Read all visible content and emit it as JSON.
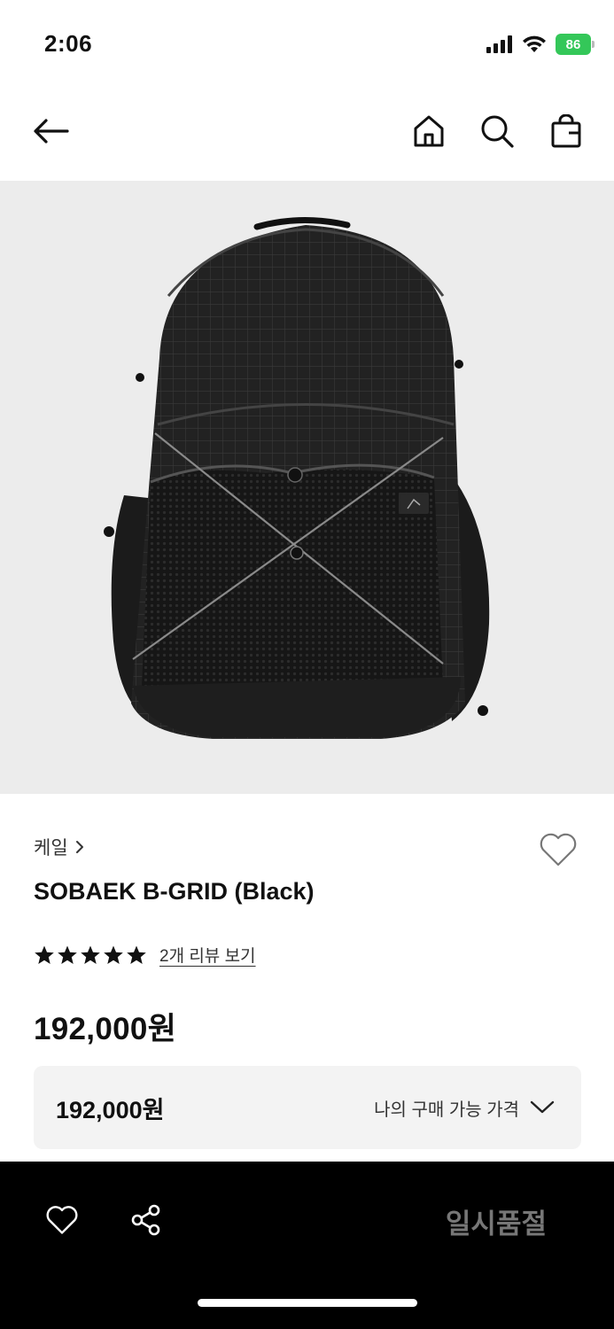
{
  "status": {
    "time": "2:06",
    "battery": "86"
  },
  "nav": {
    "back_icon": "back-arrow-icon",
    "home_icon": "home-icon",
    "search_icon": "search-icon",
    "cart_icon": "shopping-bag-icon"
  },
  "product": {
    "image_alt": "black backpack",
    "brand": "케일",
    "name": "SOBAEK B-GRID (Black)",
    "rating_stars": 5,
    "review_link": "2개 리뷰 보기",
    "price": "192,000원"
  },
  "price_box": {
    "amount": "192,000원",
    "label": "나의 구매 가능 가격"
  },
  "bottom_bar": {
    "status": "일시품절"
  },
  "colors": {
    "image_bg": "#ececec",
    "price_box_bg": "#f3f3f3",
    "bottom_bar_bg": "#000000",
    "soldout_text": "#777777",
    "battery": "#34c759"
  }
}
